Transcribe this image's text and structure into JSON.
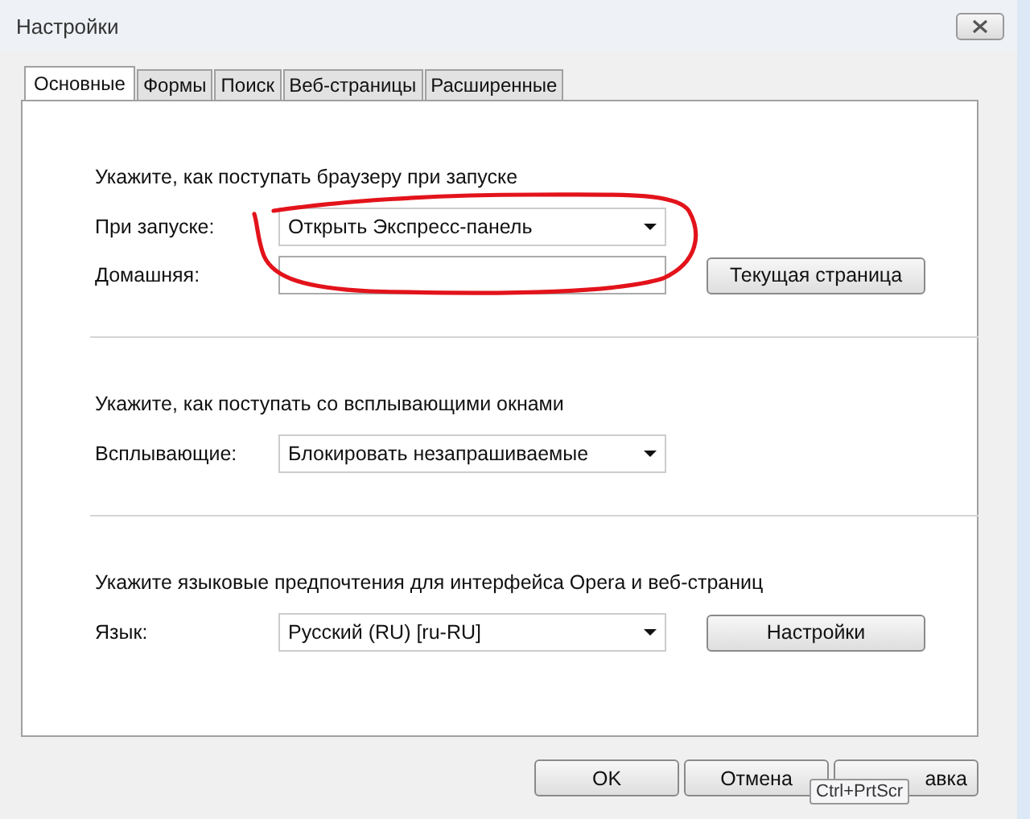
{
  "window": {
    "title": "Настройки"
  },
  "tabs": [
    {
      "label": "Основные",
      "selected": true
    },
    {
      "label": "Формы",
      "selected": false
    },
    {
      "label": "Поиск",
      "selected": false
    },
    {
      "label": "Веб-страницы",
      "selected": false
    },
    {
      "label": "Расширенные",
      "selected": false
    }
  ],
  "sections": [
    {
      "heading": "Укажите, как поступать браузеру при запуске",
      "rows": [
        {
          "kind": "dropdown",
          "label": "При запуске:",
          "value": "Открыть Экспресс-панель"
        },
        {
          "kind": "input",
          "label": "Домашняя:",
          "button": "Текущая страница"
        }
      ]
    },
    {
      "heading": "Укажите, как поступать со всплывающими окнами",
      "rows": [
        {
          "kind": "dropdown",
          "label": "Всплывающие:",
          "value": "Блокировать незапрашиваемые"
        }
      ]
    },
    {
      "heading": "Укажите языковые предпочтения для интерфейса Opera и веб-страниц",
      "rows": [
        {
          "kind": "dropdown",
          "label": "Язык:",
          "value": "Русский (RU) [ru-RU]",
          "button": "Настройки"
        }
      ]
    }
  ],
  "buttons": [
    "OK",
    "Отмена",
    "авка"
  ],
  "tooltip": "Ctrl+PrtScr"
}
